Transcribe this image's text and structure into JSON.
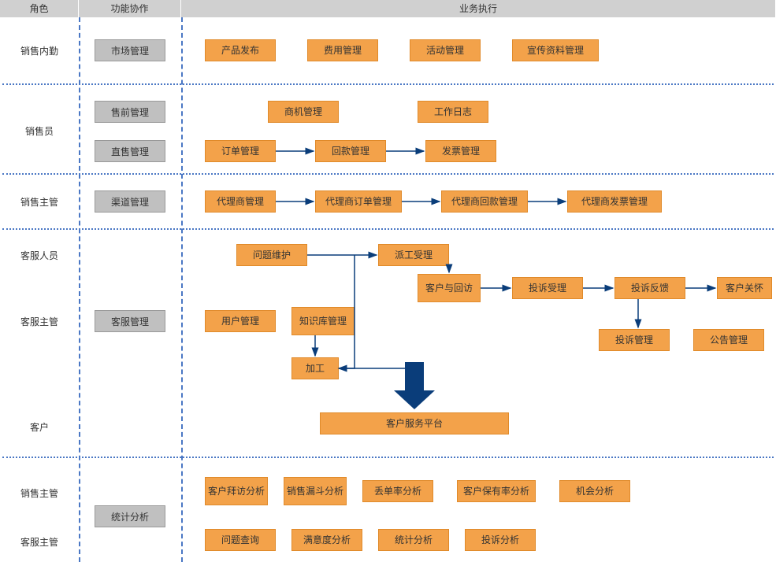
{
  "header": {
    "role": "角色",
    "func": "功能协作",
    "exec": "业务执行"
  },
  "roles": {
    "r1": "销售内勤",
    "r2": "销售员",
    "r3": "销售主管",
    "r4": "客服人员",
    "r5": "客服主管",
    "r6": "客户",
    "r7": "销售主管",
    "r8": "客服主管"
  },
  "func": {
    "f1": "市场管理",
    "f2": "售前管理",
    "f3": "直售管理",
    "f4": "渠道管理",
    "f5": "客服管理",
    "f6": "统计分析"
  },
  "exec": {
    "e1": "产品发布",
    "e2": "费用管理",
    "e3": "活动管理",
    "e4": "宣传资料管理",
    "e5": "商机管理",
    "e6": "工作日志",
    "e7": "订单管理",
    "e8": "回款管理",
    "e9": "发票管理",
    "e10": "代理商管理",
    "e11": "代理商订单管理",
    "e12": "代理商回款管理",
    "e13": "代理商发票管理",
    "e14": "问题维护",
    "e15": "派工受理",
    "e16": "客户与回访",
    "e17": "投诉受理",
    "e18": "投诉反馈",
    "e19": "客户关怀",
    "e20": "用户管理",
    "e21": "知识库管理",
    "e22": "投诉管理",
    "e23": "公告管理",
    "e24": "加工",
    "e25": "客户服务平台",
    "e26": "客户拜访分析",
    "e27": "销售漏斗分析",
    "e28": "丢单率分析",
    "e29": "客户保有率分析",
    "e30": "机会分析",
    "e31": "问题查询",
    "e32": "满意度分析",
    "e33": "统计分析",
    "e34": "投诉分析"
  }
}
